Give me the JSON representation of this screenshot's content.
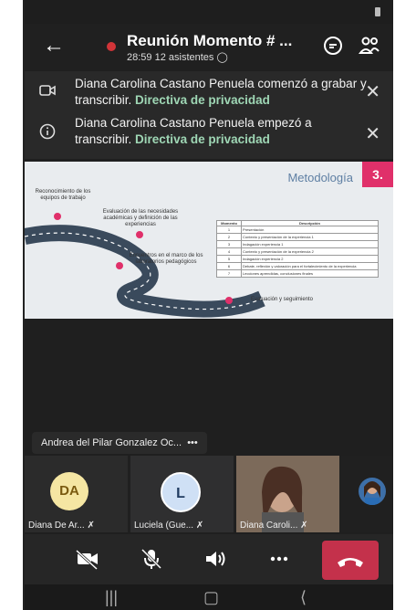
{
  "meeting": {
    "title": "Reunión Momento # ...",
    "timer": "28:59",
    "attendees": "12 asistentes"
  },
  "banners": [
    {
      "text": "Diana Carolina Castano Penuela comenzó a grabar y transcribir.",
      "link": "Directiva de privacidad"
    },
    {
      "text": "Diana Carolina Castano Penuela empezó a transcribir.",
      "link": "Directiva de privacidad"
    }
  ],
  "slide": {
    "title": "Metodología",
    "number": "3.",
    "labels": [
      "Reconocimiento de los equipos de trabajo",
      "Evaluación de las necesidades académicas y definición de las experiencias",
      "Encuentros en el marco de los laboratorios pedagógicos",
      "Evaluación y seguimiento"
    ],
    "table_headers": [
      "Momento",
      "Descripción"
    ],
    "table_rows": [
      [
        "1",
        "Presentación"
      ],
      [
        "2",
        "Contexto y presentación de la experiencia 1"
      ],
      [
        "3",
        "Indagación experiencia 1"
      ],
      [
        "4",
        "Contexto y presentación de la experiencia 2"
      ],
      [
        "5",
        "Indagación experiencia 2"
      ],
      [
        "6",
        "Debate, reflexión y valoración para el fortalecimiento de la experiencia"
      ],
      [
        "7",
        "Lecciones aprendidas, conclusiones finales"
      ]
    ]
  },
  "presenter_name": "Andrea del Pilar Gonzalez Oc...",
  "more_label": "•••",
  "participants": [
    {
      "initials": "DA",
      "name": "Diana De Ar...",
      "avatar_color": "#f5e6a3"
    },
    {
      "initials": "L",
      "name": "Luciela (Gue...",
      "avatar_color": "#cfe0f5"
    },
    {
      "initials": "",
      "name": "Diana Caroli...",
      "avatar_color": "#8a7060"
    }
  ],
  "colors": {
    "background": "#1f1f1f",
    "recording": "#d13438",
    "link": "#9fd7b5",
    "hangup": "#c4314b",
    "slide_accent": "#e0306a"
  }
}
